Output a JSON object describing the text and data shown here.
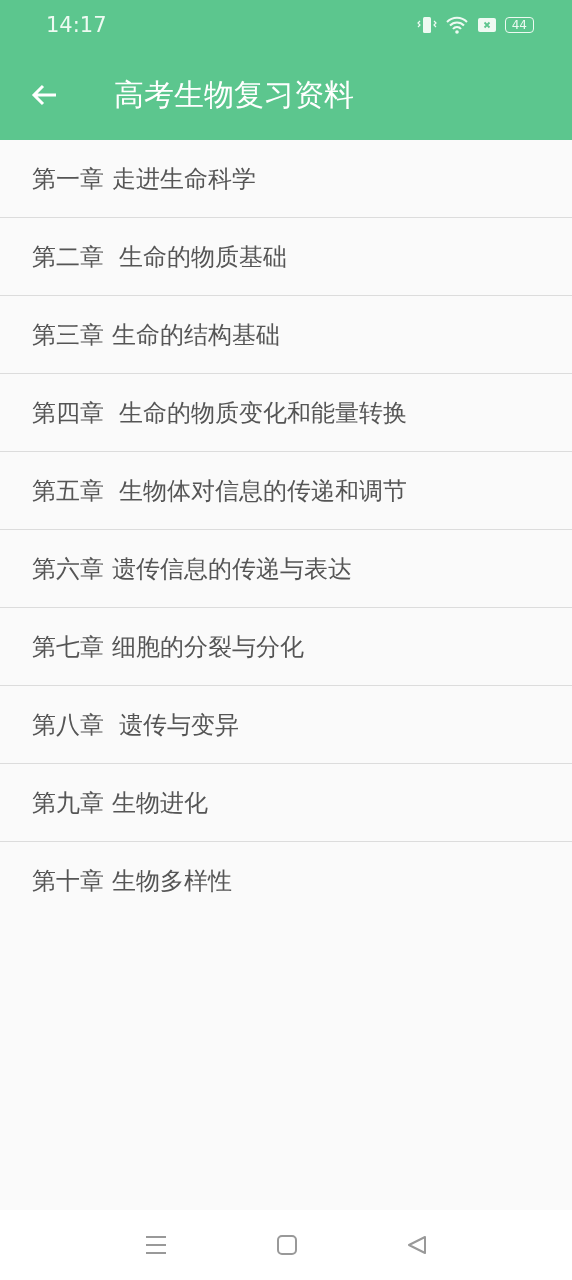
{
  "status_bar": {
    "time": "14:17",
    "battery": "44"
  },
  "app_bar": {
    "title": "高考生物复习资料"
  },
  "chapters": [
    {
      "label": "第一章 走进生命科学"
    },
    {
      "label": "第二章  生命的物质基础"
    },
    {
      "label": "第三章 生命的结构基础"
    },
    {
      "label": "第四章  生命的物质变化和能量转换"
    },
    {
      "label": "第五章  生物体对信息的传递和调节"
    },
    {
      "label": "第六章 遗传信息的传递与表达"
    },
    {
      "label": "第七章 细胞的分裂与分化"
    },
    {
      "label": "第八章  遗传与变异"
    },
    {
      "label": "第九章 生物进化"
    },
    {
      "label": "第十章 生物多样性"
    }
  ]
}
